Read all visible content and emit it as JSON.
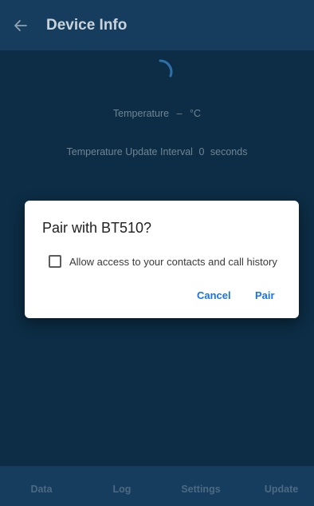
{
  "appbar": {
    "title": "Device Info",
    "back_icon": "arrow-left-icon"
  },
  "content": {
    "temperature_label": "Temperature",
    "temperature_value": "–",
    "temperature_unit": "°C",
    "interval_label": "Temperature Update Interval",
    "interval_value": "0",
    "interval_unit": "seconds"
  },
  "tabs": [
    {
      "label": "Data",
      "icon": "magnet-icon"
    },
    {
      "label": "Log",
      "icon": "running-person-icon"
    },
    {
      "label": "Settings",
      "icon": "thermometer-icon"
    },
    {
      "label": "Update",
      "icon": "thermometer-icon"
    }
  ],
  "dialog": {
    "title": "Pair with BT510?",
    "checkbox_label": "Allow access to your contacts and call history",
    "checkbox_checked": false,
    "cancel_label": "Cancel",
    "pair_label": "Pair"
  },
  "colors": {
    "background": "#0c2d45",
    "appbar": "#163d5e",
    "accent": "#1a73e8",
    "icon_muted": "#3f5a72"
  }
}
